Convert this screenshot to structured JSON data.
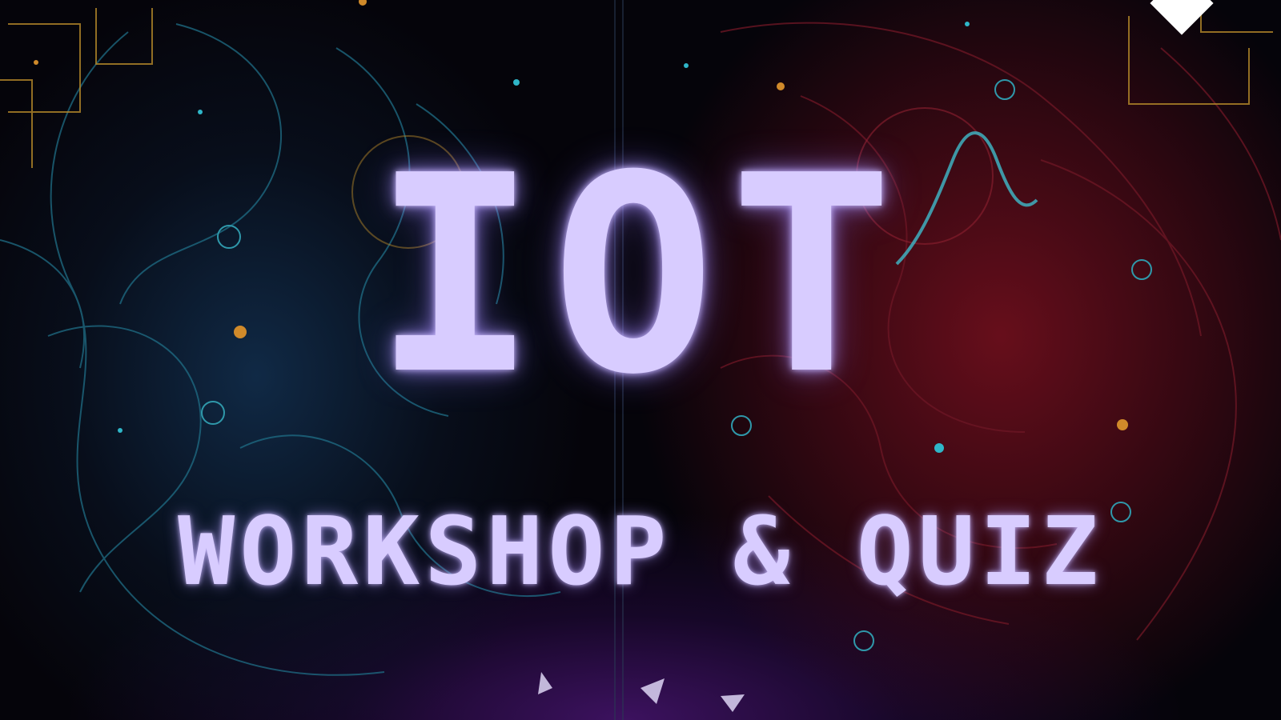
{
  "poster": {
    "title": "IOT",
    "subtitle": "WORKSHOP & QUIZ"
  },
  "colors": {
    "title_text": "#d8ccff",
    "background": "#05040a",
    "left_brain_tint": "#123050",
    "right_brain_tint": "#78101e",
    "bottom_glow": "#46146e",
    "circuit_cyan": "#2fb6c8",
    "circuit_orange": "#d08a2a"
  },
  "icons": {
    "corner_mark": "diamond-icon"
  }
}
